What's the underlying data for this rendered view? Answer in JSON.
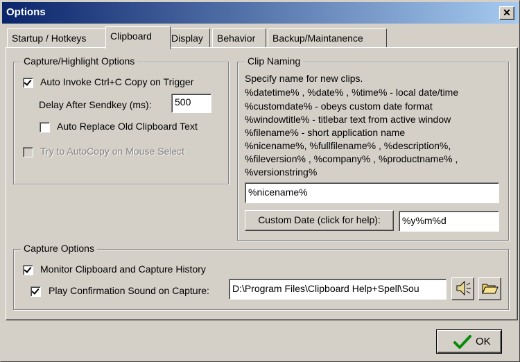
{
  "window": {
    "title": "Options",
    "close_label": "✕"
  },
  "tabs": [
    {
      "label": "Startup / Hotkeys"
    },
    {
      "label": "Clipboard"
    },
    {
      "label": "Display"
    },
    {
      "label": "Behavior"
    },
    {
      "label": "Backup/Maintanence"
    }
  ],
  "capture_highlight": {
    "title": "Capture/Highlight Options",
    "auto_invoke_label": "Auto Invoke Ctrl+C Copy on Trigger",
    "auto_invoke_checked": true,
    "delay_label": "Delay After Sendkey (ms):",
    "delay_value": "500",
    "auto_replace_label": "Auto Replace Old Clipboard Text",
    "auto_replace_checked": false,
    "autocopy_label": "Try to AutoCopy on Mouse Select",
    "autocopy_checked": false
  },
  "clip_naming": {
    "title": "Clip Naming",
    "help_lines": [
      "Specify name for new clips.",
      "%datetime% , %date% , %time% - local date/time",
      "%customdate% - obeys custom date format",
      "%windowtitle% - titlebar text from active window",
      "%filename% - short application name",
      "%nicename%, %fullfilename% , %description%,",
      "%fileversion% , %company% , %productname% ,",
      "%versionstring%"
    ],
    "name_value": "%nicename%",
    "custom_date_button": "Custom Date (click for help):",
    "custom_date_value": "%y%m%d"
  },
  "capture_options": {
    "title": "Capture Options",
    "monitor_label": "Monitor Clipboard and Capture History",
    "monitor_checked": true,
    "sound_label": "Play Confirmation Sound on Capture:",
    "sound_checked": true,
    "sound_path": "D:\\Program Files\\Clipboard Help+Spell\\Sou"
  },
  "footer": {
    "ok_label": "OK"
  },
  "icons": {
    "speaker": "speaker-icon",
    "folder": "folder-open-icon",
    "check": "green-check-icon"
  },
  "colors": {
    "title_start": "#0a246a",
    "title_end": "#a6caf0",
    "face": "#d4d0c8"
  }
}
